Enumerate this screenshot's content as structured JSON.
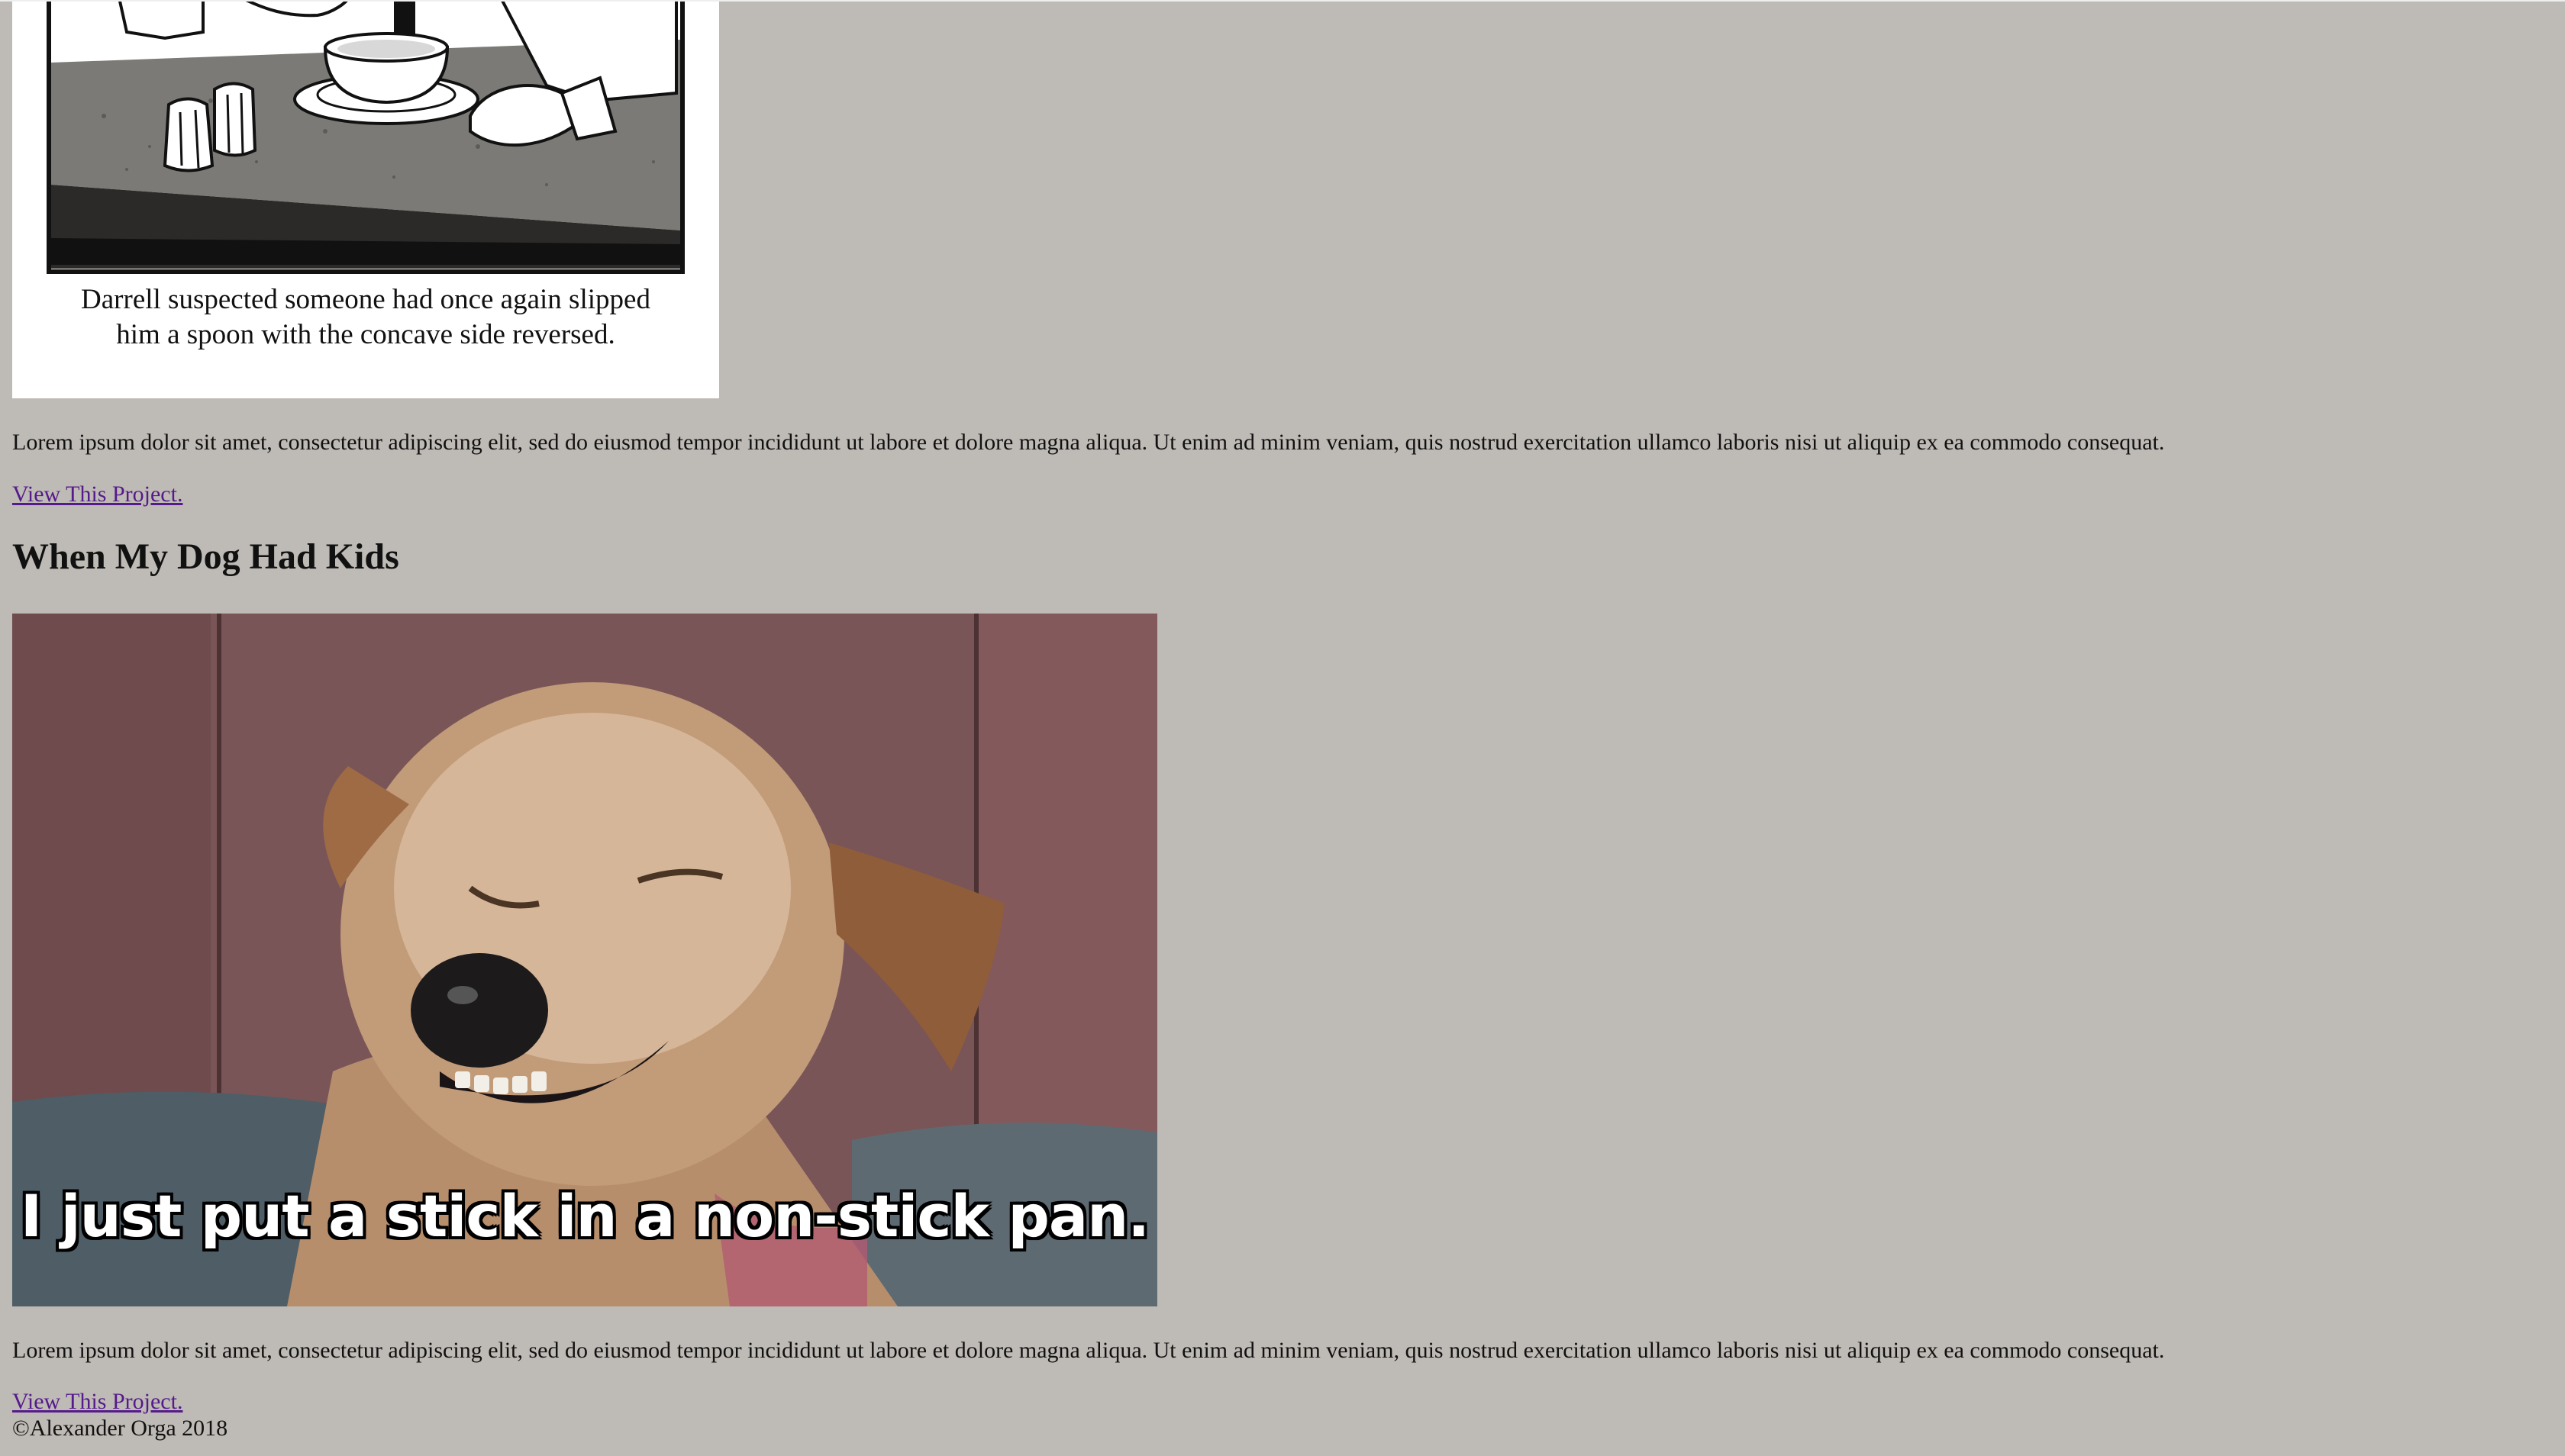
{
  "project1": {
    "comic_caption_line1": "Darrell suspected someone had once again slipped",
    "comic_caption_line2": "him a spoon with the concave side reversed.",
    "description": "Lorem ipsum dolor sit amet, consectetur adipiscing elit, sed do eiusmod tempor incididunt ut labore et dolore magna aliqua. Ut enim ad minim veniam, quis nostrud exercitation ullamco laboris nisi ut aliquip ex ea commodo consequat.",
    "link_label": "View This Project."
  },
  "project2": {
    "title": "When My Dog Had Kids",
    "meme_caption": "I just put a stick in a non-stick pan.",
    "description": "Lorem ipsum dolor sit amet, consectetur adipiscing elit, sed do eiusmod tempor incididunt ut labore et dolore magna aliqua. Ut enim ad minim veniam, quis nostrud exercitation ullamco laboris nisi ut aliquip ex ea commodo consequat.",
    "link_label": "View This Project."
  },
  "footer": {
    "copyright": "©Alexander Orga 2018"
  },
  "colors": {
    "background": "#bebab5",
    "link": "#551a8b"
  }
}
